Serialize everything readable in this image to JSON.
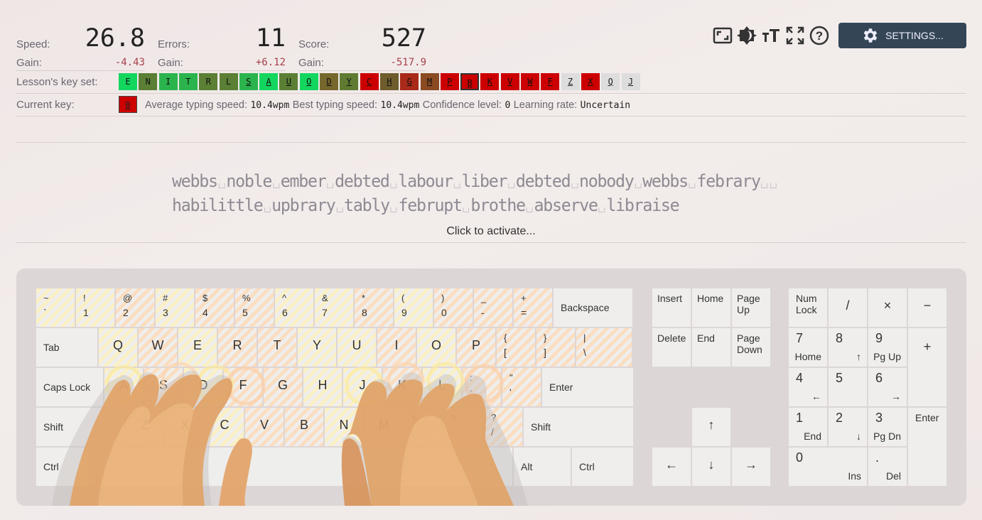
{
  "stats": {
    "speed_label": "Speed:",
    "speed": "26.8",
    "speed_gain_label": "Gain:",
    "speed_gain": "-4.43",
    "errors_label": "Errors:",
    "errors": "11",
    "errors_gain_label": "Gain:",
    "errors_gain": "+6.12",
    "score_label": "Score:",
    "score": "527",
    "score_gain_label": "Gain:",
    "score_gain": "-517.9"
  },
  "toolbar": {
    "icons": [
      "window-size-icon",
      "theme-contrast-icon",
      "font-size-icon",
      "fullscreen-icon",
      "help-icon"
    ],
    "settings_label": "SETTINGS..."
  },
  "keyset": {
    "label": "Lesson's key set:",
    "keys": [
      {
        "k": "E",
        "c": "#13d65f",
        "u": false
      },
      {
        "k": "N",
        "c": "#5b7f35",
        "u": false
      },
      {
        "k": "I",
        "c": "#2bb44d",
        "u": false
      },
      {
        "k": "T",
        "c": "#2bb44d",
        "u": false
      },
      {
        "k": "R",
        "c": "#5b7f35",
        "u": false
      },
      {
        "k": "L",
        "c": "#5b7f35",
        "u": false
      },
      {
        "k": "S",
        "c": "#2bb44d",
        "u": true
      },
      {
        "k": "A",
        "c": "#13d65f",
        "u": true
      },
      {
        "k": "U",
        "c": "#5b7f35",
        "u": true
      },
      {
        "k": "O",
        "c": "#13d65f",
        "u": true
      },
      {
        "k": "D",
        "c": "#76672c",
        "u": true
      },
      {
        "k": "Y",
        "c": "#5f7b32",
        "u": true
      },
      {
        "k": "C",
        "c": "#cc0000",
        "u": true
      },
      {
        "k": "H",
        "c": "#6f5c2c",
        "u": true
      },
      {
        "k": "G",
        "c": "#aa2a1a",
        "u": true
      },
      {
        "k": "M",
        "c": "#8a4a22",
        "u": true
      },
      {
        "k": "P",
        "c": "#cc0000",
        "u": true
      },
      {
        "k": "B",
        "c": "#cc0000",
        "u": true,
        "current": true
      },
      {
        "k": "K",
        "c": "#cc0000",
        "u": true
      },
      {
        "k": "V",
        "c": "#cc0000",
        "u": true
      },
      {
        "k": "W",
        "c": "#cc0000",
        "u": true
      },
      {
        "k": "F",
        "c": "#cc0000",
        "u": true
      },
      {
        "k": "Z",
        "c": "#dddddd",
        "u": true
      },
      {
        "k": "X",
        "c": "#cc0000",
        "u": true
      },
      {
        "k": "Q",
        "c": "#dddddd",
        "u": true
      },
      {
        "k": "J",
        "c": "#dddddd",
        "u": true
      }
    ]
  },
  "current": {
    "label": "Current key:",
    "key": "B",
    "color": "#cc0000",
    "avg_label": "Average typing speed:",
    "avg": "10.4wpm",
    "best_label": "Best typing speed:",
    "best": "10.4wpm",
    "conf_label": "Confidence level:",
    "conf": "0",
    "rate_label": "Learning rate:",
    "rate": "Uncertain"
  },
  "lesson": {
    "line1": [
      "webbs",
      "noble",
      "ember",
      "debted",
      "labour",
      "liber",
      "debted",
      "nobody",
      "webbs",
      "febrary",
      ""
    ],
    "line2": [
      "habilittle",
      "upbrary",
      "tably",
      "februpt",
      "brothe",
      "abserve",
      "libraise"
    ],
    "activate": "Click to activate..."
  },
  "keyboard": {
    "rows": [
      [
        {
          "t": "~",
          "b": "`",
          "z": "y"
        },
        {
          "t": "!",
          "b": "1",
          "z": "y"
        },
        {
          "t": "@",
          "b": "2",
          "z": "o"
        },
        {
          "t": "#",
          "b": "3",
          "z": "y"
        },
        {
          "t": "$",
          "b": "4",
          "z": "o"
        },
        {
          "t": "%",
          "b": "5",
          "z": "o"
        },
        {
          "t": "^",
          "b": "6",
          "z": "y"
        },
        {
          "t": "&",
          "b": "7",
          "z": "y"
        },
        {
          "t": "*",
          "b": "8",
          "z": "o"
        },
        {
          "t": "(",
          "b": "9",
          "z": "y"
        },
        {
          "t": ")",
          "b": "0",
          "z": "o"
        },
        {
          "t": "_",
          "b": "-",
          "z": "o"
        },
        {
          "t": "+",
          "b": "=",
          "z": "o"
        },
        {
          "t": "",
          "b": "Backspace",
          "z": ""
        }
      ],
      [
        {
          "t": "",
          "b": "Tab",
          "z": ""
        },
        {
          "t": "",
          "b": "Q",
          "z": "y"
        },
        {
          "t": "",
          "b": "W",
          "z": "o"
        },
        {
          "t": "",
          "b": "E",
          "z": "y"
        },
        {
          "t": "",
          "b": "R",
          "z": "o"
        },
        {
          "t": "",
          "b": "T",
          "z": "o"
        },
        {
          "t": "",
          "b": "Y",
          "z": "y"
        },
        {
          "t": "",
          "b": "U",
          "z": "y"
        },
        {
          "t": "",
          "b": "I",
          "z": "o"
        },
        {
          "t": "",
          "b": "O",
          "z": "y"
        },
        {
          "t": "",
          "b": "P",
          "z": "o"
        },
        {
          "t": "{",
          "b": "[",
          "z": "o"
        },
        {
          "t": "}",
          "b": "]",
          "z": "o"
        },
        {
          "t": "|",
          "b": "\\",
          "z": "o"
        }
      ],
      [
        {
          "t": "",
          "b": "Caps Lock",
          "z": ""
        },
        {
          "t": "",
          "b": "A",
          "z": "y"
        },
        {
          "t": "",
          "b": "S",
          "z": "o"
        },
        {
          "t": "",
          "b": "D",
          "z": "y"
        },
        {
          "t": "",
          "b": "F",
          "z": "o"
        },
        {
          "t": "",
          "b": "G",
          "z": "o"
        },
        {
          "t": "",
          "b": "H",
          "z": "y"
        },
        {
          "t": "",
          "b": "J",
          "z": "y"
        },
        {
          "t": "",
          "b": "K",
          "z": "o"
        },
        {
          "t": "",
          "b": "L",
          "z": "y"
        },
        {
          "t": ":",
          "b": ";",
          "z": "o"
        },
        {
          "t": "\"",
          "b": "'",
          "z": "o"
        },
        {
          "t": "",
          "b": "Enter",
          "z": ""
        }
      ],
      [
        {
          "t": "",
          "b": "Shift",
          "z": ""
        },
        {
          "t": "",
          "b": "Z",
          "z": "y"
        },
        {
          "t": "",
          "b": "X",
          "z": "o"
        },
        {
          "t": "",
          "b": "C",
          "z": "y"
        },
        {
          "t": "",
          "b": "V",
          "z": "o"
        },
        {
          "t": "",
          "b": "B",
          "z": "o"
        },
        {
          "t": "",
          "b": "N",
          "z": "y"
        },
        {
          "t": "",
          "b": "M",
          "z": "y"
        },
        {
          "t": "<",
          "b": ",",
          "z": "o"
        },
        {
          "t": ">",
          "b": ".",
          "z": "y"
        },
        {
          "t": "?",
          "b": "/",
          "z": "o"
        },
        {
          "t": "",
          "b": "Shift",
          "z": ""
        }
      ],
      [
        {
          "t": "",
          "b": "Ctrl",
          "z": ""
        },
        {
          "t": "",
          "b": "",
          "z": ""
        },
        {
          "t": "",
          "b": "Alt",
          "z": ""
        },
        {
          "t": "",
          "b": "Ctrl",
          "z": ""
        }
      ]
    ],
    "nav": [
      "Insert",
      "Home",
      "Page Up",
      "Delete",
      "End",
      "Page Down",
      "↑",
      "←",
      "↓",
      "→"
    ],
    "numpad": [
      {
        "m": "Num Lock",
        "s": ""
      },
      {
        "m": "/",
        "s": ""
      },
      {
        "m": "×",
        "s": ""
      },
      {
        "m": "−",
        "s": ""
      },
      {
        "m": "7",
        "s": "Home"
      },
      {
        "m": "8",
        "s": "↑"
      },
      {
        "m": "9",
        "s": "Pg Up"
      },
      {
        "m": "+",
        "s": ""
      },
      {
        "m": "4",
        "s": "←"
      },
      {
        "m": "5",
        "s": ""
      },
      {
        "m": "6",
        "s": "→"
      },
      {
        "m": "1",
        "s": "End"
      },
      {
        "m": "2",
        "s": "↓"
      },
      {
        "m": "3",
        "s": "Pg Dn"
      },
      {
        "m": "Enter",
        "s": ""
      },
      {
        "m": "0",
        "s": "Ins"
      },
      {
        "m": ".",
        "s": "Del"
      }
    ]
  }
}
